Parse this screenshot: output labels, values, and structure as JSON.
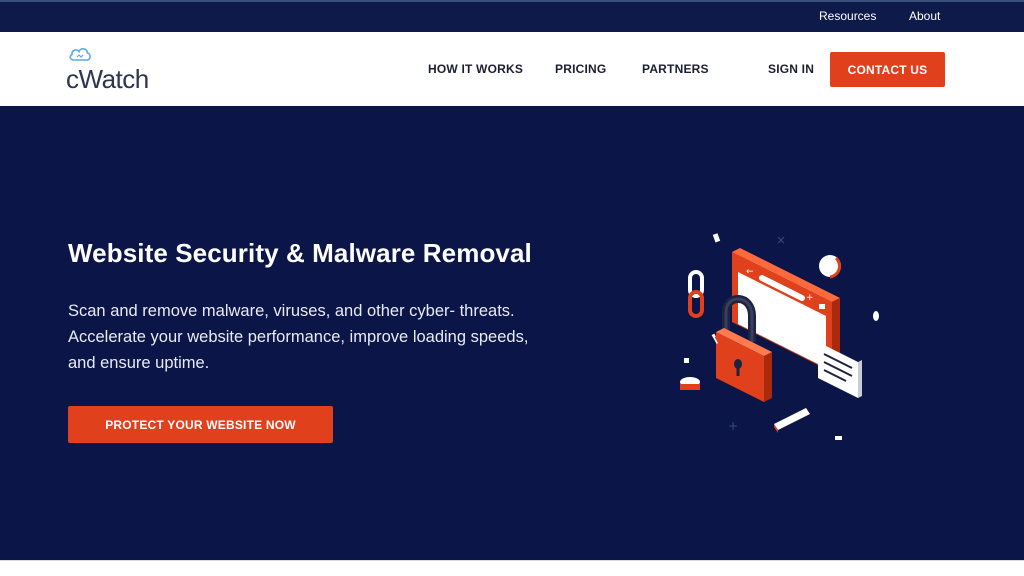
{
  "topbar": {
    "resources": "Resources",
    "about": "About"
  },
  "brand": {
    "name": "cWatch",
    "logo_icon": "cloud-icon"
  },
  "nav": {
    "items": [
      {
        "label": "HOW IT WORKS"
      },
      {
        "label": "PRICING"
      },
      {
        "label": "PARTNERS"
      }
    ],
    "sign_in": "SIGN IN",
    "contact": "CONTACT US"
  },
  "hero": {
    "title": "Website Security & Malware Removal",
    "description_lines": [
      "Scan and remove malware, viruses, and other cyber- threats.",
      "Accelerate your website performance, improve loading speeds,",
      "and ensure uptime."
    ],
    "cta": "PROTECT YOUR WEBSITE NOW",
    "illustration": "padlock-browser-illustration"
  },
  "colors": {
    "topbar_bg": "#0d1a4a",
    "hero_bg": "#0b1547",
    "accent": "#e0401b",
    "text_dark": "#1b1f33"
  }
}
